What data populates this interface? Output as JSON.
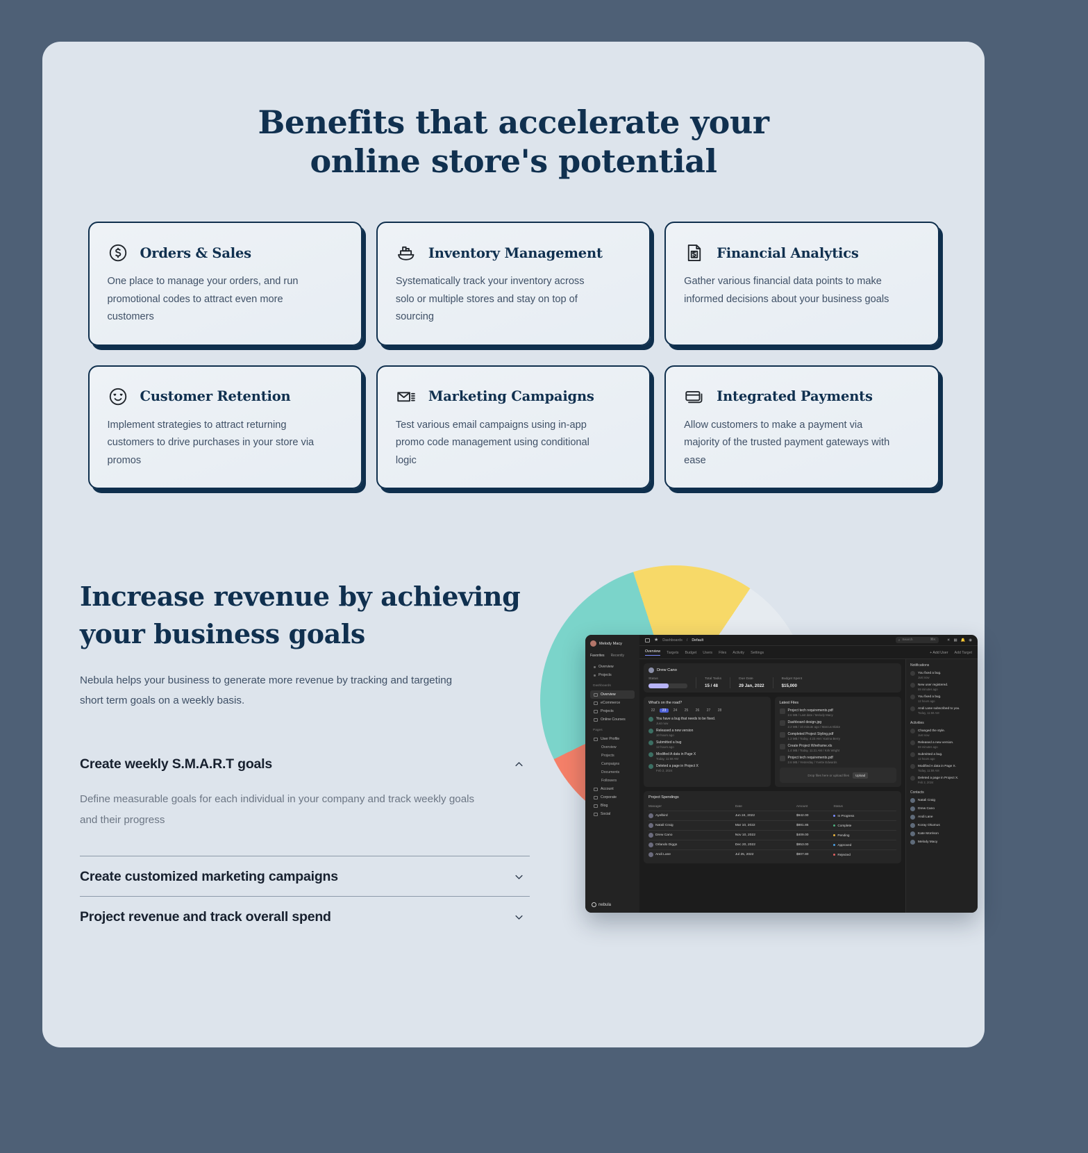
{
  "hero": {
    "title_line1": "Benefits that accelerate your",
    "title_line2": "online store's potential"
  },
  "features": [
    {
      "icon": "dollar-circle-icon",
      "title": "Orders & Sales",
      "desc": "One place to manage your orders, and run promotional codes to attract even more customers"
    },
    {
      "icon": "cargo-boat-icon",
      "title": "Inventory Management",
      "desc": "Systematically track your inventory across solo or multiple stores and stay on top of sourcing"
    },
    {
      "icon": "financial-document-icon",
      "title": "Financial Analytics",
      "desc": "Gather various financial data points to make informed decisions about your business goals"
    },
    {
      "icon": "heart-eyes-smiley-icon",
      "title": "Customer Retention",
      "desc": "Implement strategies to attract returning customers to drive purchases in your store via promos"
    },
    {
      "icon": "envelope-list-icon",
      "title": "Marketing Campaigns",
      "desc": "Test various email campaigns using in-app promo code management using conditional logic"
    },
    {
      "icon": "credit-cards-icon",
      "title": "Integrated Payments",
      "desc": "Allow customers to make a payment via majority of the trusted payment gateways with ease"
    }
  ],
  "revenue": {
    "title_line1": "Increase revenue by achieving",
    "title_line2": "your business goals",
    "subtitle": "Nebula helps your business to generate more revenue by tracking and targeting short term goals on a weekly basis.",
    "accordion": [
      {
        "title": "Create weekly S.M.A.R.T goals",
        "body": "Define measurable goals for each individual in your company and track weekly goals and their progress",
        "expanded": true,
        "chevron": "chevron-up-icon"
      },
      {
        "title": "Create customized marketing campaigns",
        "body": "",
        "expanded": false,
        "chevron": "chevron-down-icon"
      },
      {
        "title": "Project revenue and track overall spend",
        "body": "",
        "expanded": false,
        "chevron": "chevron-down-icon"
      }
    ]
  },
  "dashboard": {
    "user": "Melody Macy",
    "side_tabs": [
      "Favorites",
      "Recently"
    ],
    "nav_top": [
      "Overview",
      "Projects"
    ],
    "dashboards_caption": "Dashboards",
    "dashboards": [
      "Overview",
      "eCommerce",
      "Projects",
      "Online Courses"
    ],
    "pages_caption": "Pages",
    "pages": [
      "User Profile",
      "Overview",
      "Projects",
      "Campaigns",
      "Documents",
      "Followers",
      "Account",
      "Corporate",
      "Blog",
      "Social"
    ],
    "brand": "nebula",
    "breadcrumb": [
      "Dashboards",
      "Default"
    ],
    "search_placeholder": "Search",
    "search_shortcut": "⌘K",
    "tabs": [
      "Overview",
      "Targets",
      "Budget",
      "Users",
      "Files",
      "Activity",
      "Settings"
    ],
    "actions": [
      "+ Add User",
      "Add Target"
    ],
    "project": {
      "name": "Drew Cano",
      "status_label": "Status",
      "stats": [
        {
          "label": "Total Tasks",
          "value": "15 / 48"
        },
        {
          "label": "Due Date",
          "value": "29 Jan, 2022"
        },
        {
          "label": "Budget Spent",
          "value": "$15,000"
        }
      ]
    },
    "whats_on_road": {
      "title": "What's on the road?",
      "days": [
        "22",
        "23",
        "24",
        "25",
        "26",
        "27",
        "28"
      ],
      "selected_day": "23",
      "activities": [
        {
          "text": "You have a bug that needs to be fixed.",
          "time": "Just now"
        },
        {
          "text": "Released a new version",
          "time": "10 hours ago"
        },
        {
          "text": "Submitted a bug",
          "time": "12 hours ago"
        },
        {
          "text": "Modified A data in Page X",
          "time": "Today, 11:59 AM"
        },
        {
          "text": "Deleted a page in Project X",
          "time": "Feb 2, 2024"
        }
      ]
    },
    "latest_files": {
      "title": "Latest Files",
      "files": [
        {
          "name": "Project tech requirements.pdf",
          "meta": "2.6 MB / Last date / Melody Macy"
        },
        {
          "name": "Dashboard design.jpg",
          "meta": "2.2 MB / 10 minute ago / Marcus Blake"
        },
        {
          "name": "Completed Project Styling.pdf",
          "meta": "1.2 MB / Today, 4:23 AM / Karina Berry"
        },
        {
          "name": "Create Project Wireframe.xls",
          "meta": "1.4 MB / Today, 11:21 AM / Kirk Wright"
        },
        {
          "name": "Project tech requirements.pdf",
          "meta": "2.6 MB / Yesterday / Yvette Edwards"
        }
      ],
      "drop_text": "Drop files here or upload files",
      "upload_label": "Upload"
    },
    "spendings": {
      "title": "Project Spendings",
      "columns": [
        "Manager",
        "Date",
        "Amount",
        "Status"
      ],
      "rows": [
        {
          "manager": "Ayelbird",
          "date": "Jun 24, 2022",
          "amount": "$942.00",
          "status": "In Progress",
          "color": "#7b8cff"
        },
        {
          "manager": "Natali Craig",
          "date": "Mar 10, 2022",
          "amount": "$881.85",
          "status": "Complete",
          "color": "#4caf7d"
        },
        {
          "manager": "Drew Cano",
          "date": "Nov 10, 2022",
          "amount": "$409.00",
          "status": "Pending",
          "color": "#e8b33d"
        },
        {
          "manager": "Orlando Diggs",
          "date": "Dec 20, 2022",
          "amount": "$953.00",
          "status": "Approved",
          "color": "#4a9de0"
        },
        {
          "manager": "Andi Lane",
          "date": "Jul 25, 2022",
          "amount": "$907.80",
          "status": "Rejected",
          "color": "#e06060"
        }
      ]
    },
    "notifications": {
      "title": "Notifications",
      "items": [
        {
          "text": "You fixed a bug.",
          "time": "Just now"
        },
        {
          "text": "New user registered.",
          "time": "59 minutes ago"
        },
        {
          "text": "You fixed a bug.",
          "time": "12 hours ago"
        },
        {
          "text": "Andi Lane subscribed to you.",
          "time": "Today, 11:59 AM"
        }
      ]
    },
    "activities": {
      "title": "Activities",
      "items": [
        {
          "text": "Changed the style.",
          "time": "Just now"
        },
        {
          "text": "Released a new version.",
          "time": "59 minutes ago"
        },
        {
          "text": "Submitted a bug.",
          "time": "12 hours ago"
        },
        {
          "text": "Modified A data in Page X.",
          "time": "Today, 11:59 AM"
        },
        {
          "text": "Deleted a page in Project X.",
          "time": "Feb 2, 2024"
        }
      ]
    },
    "contacts": {
      "title": "Contacts",
      "items": [
        "Natali Craig",
        "Drew Cano",
        "Andi Lane",
        "Koray Okumus",
        "Kate Morrison",
        "Melody Macy"
      ]
    }
  },
  "colors": {
    "page_bg": "#dde4ec",
    "outer_bg": "#4e6076",
    "ink": "#10304f",
    "body": "#3f5066",
    "muted": "#6c7684",
    "pie_teal": "#7bd4ca",
    "pie_yellow": "#f7d968",
    "pie_coral": "#f58069",
    "pie_grey": "#e6ebf0"
  }
}
